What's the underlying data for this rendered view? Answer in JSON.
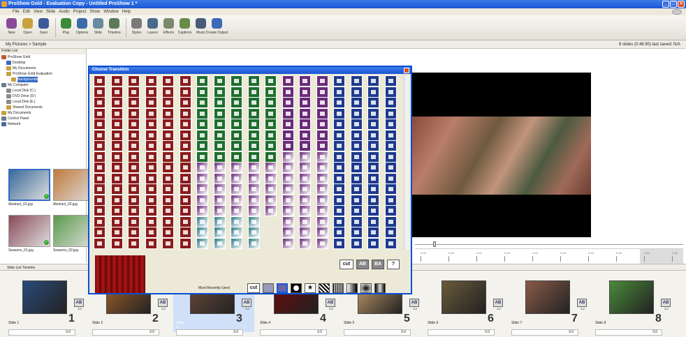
{
  "window": {
    "title": "ProShow Gold - Evaluation Copy - Untitled ProShow 1 *"
  },
  "menu": [
    "File",
    "Edit",
    "View",
    "Slide",
    "Audio",
    "Project",
    "Show",
    "Window",
    "Help"
  ],
  "toolbar": [
    {
      "label": "New",
      "icon": "new-icon",
      "color": "#8a4a9a"
    },
    {
      "label": "Open",
      "icon": "open-folder-icon",
      "color": "#c8a040"
    },
    {
      "label": "Save",
      "icon": "save-icon",
      "color": "#3a5a9a"
    },
    {
      "label": "Play",
      "icon": "play-icon",
      "color": "#3a8a3a"
    },
    {
      "label": "Options",
      "icon": "options-icon",
      "color": "#3a6aa8"
    },
    {
      "label": "Slide",
      "icon": "slide-icon",
      "color": "#6a8aa0"
    },
    {
      "label": "Timeline",
      "icon": "timeline-icon",
      "color": "#5a7a5a"
    },
    {
      "label": "Styles",
      "icon": "styles-icon",
      "color": "#7a7a7a"
    },
    {
      "label": "Layers",
      "icon": "layers-icon",
      "color": "#4a6a8a"
    },
    {
      "label": "Effects",
      "icon": "effects-icon",
      "color": "#7a8a6a"
    },
    {
      "label": "Captions",
      "icon": "captions-icon",
      "color": "#6a8a4a"
    },
    {
      "label": "Music",
      "icon": "music-icon",
      "color": "#4a5a7a"
    },
    {
      "label": "Create Output",
      "icon": "create-output-icon",
      "color": "#3a6ab8"
    }
  ],
  "pathbar": {
    "path": "My Pictures > Sample",
    "status": "8 slides (0:46.90)   last saved: N/A"
  },
  "tree": {
    "header": "Folder List",
    "items": [
      {
        "label": "ProShow Gold",
        "indent": 0,
        "color": "#c05a30"
      },
      {
        "label": "Desktop",
        "indent": 1,
        "color": "#3a6ab8"
      },
      {
        "label": "My Documents",
        "indent": 1,
        "color": "#c8a040"
      },
      {
        "label": "ProShow Gold Evaluation",
        "indent": 1,
        "color": "#c8a040"
      },
      {
        "label": "Backgrounds",
        "indent": 2,
        "color": "#c8a040",
        "selected": true
      },
      {
        "label": "My Computer",
        "indent": 0,
        "color": "#6a7a8a"
      },
      {
        "label": "Local Disk (C:)",
        "indent": 1,
        "color": "#8a8a8a"
      },
      {
        "label": "DVD Drive (D:)",
        "indent": 1,
        "color": "#8a8a8a"
      },
      {
        "label": "Local Disk (E:)",
        "indent": 1,
        "color": "#8a8a8a"
      },
      {
        "label": "Shared Documents",
        "indent": 1,
        "color": "#c8a040"
      },
      {
        "label": "My Documents",
        "indent": 0,
        "color": "#c8a040"
      },
      {
        "label": "Control Panel",
        "indent": 0,
        "color": "#6a7a8a"
      },
      {
        "label": "Network",
        "indent": 0,
        "color": "#4a6a9a"
      }
    ]
  },
  "files": [
    {
      "name": "Abstract_01.jpg",
      "color": "#3a6a9a"
    },
    {
      "name": "Abstract_02.jpg",
      "color": "#c07a3a"
    },
    {
      "name": "Seasons_01.jpg",
      "color": "#8a4a5a"
    },
    {
      "name": "Seasons_02.jpg",
      "color": "#5a9a4a"
    }
  ],
  "dialog": {
    "title": "Choose Transition",
    "cut_label": "cut",
    "help_label": "?",
    "ab_label": "AB"
  },
  "bottombar": {
    "random_label": "Most Recently Used",
    "cut_label": "cut"
  },
  "slidelist": {
    "header": "Slide List  Timeline"
  },
  "slides": [
    {
      "num": "1",
      "name": "Slide 1",
      "dur": "3.0",
      "trans": "3.0",
      "color": "#2a4a7a"
    },
    {
      "num": "2",
      "name": "Slide 2",
      "dur": "3.0",
      "trans": "3.0",
      "color": "#a0602a"
    },
    {
      "num": "3",
      "name": "Slide 3",
      "dur": "3.0",
      "trans": "3.0",
      "color": "#6a4a3a",
      "selected": true
    },
    {
      "num": "4",
      "name": "Slide 4",
      "dur": "3.0",
      "trans": "3.0",
      "color": "#6a0a0a"
    },
    {
      "num": "5",
      "name": "Slide 5",
      "dur": "3.0",
      "trans": "3.0",
      "color": "#c09a6a"
    },
    {
      "num": "6",
      "name": "Slide 6",
      "dur": "3.0",
      "trans": "3.0",
      "color": "#6a5a3a"
    },
    {
      "num": "7",
      "name": "Slide 7",
      "dur": "3.0",
      "trans": "3.0",
      "color": "#8a5a4a"
    },
    {
      "num": "8",
      "name": "Slide 8",
      "dur": "3.0",
      "trans": "3.0",
      "color": "#4a8a3a"
    }
  ],
  "ruler": [
    "0:00",
    "0:05",
    "0:10",
    "0:15",
    "0:20",
    "0:25",
    "0:30",
    "0:35",
    "0:40",
    "0:45"
  ],
  "colors": {
    "red": "#8a1c1c",
    "green": "#1e6e2e",
    "purple": "#6a2a7a",
    "blue": "#1e3a8e",
    "teal": "#2e7a8a"
  }
}
